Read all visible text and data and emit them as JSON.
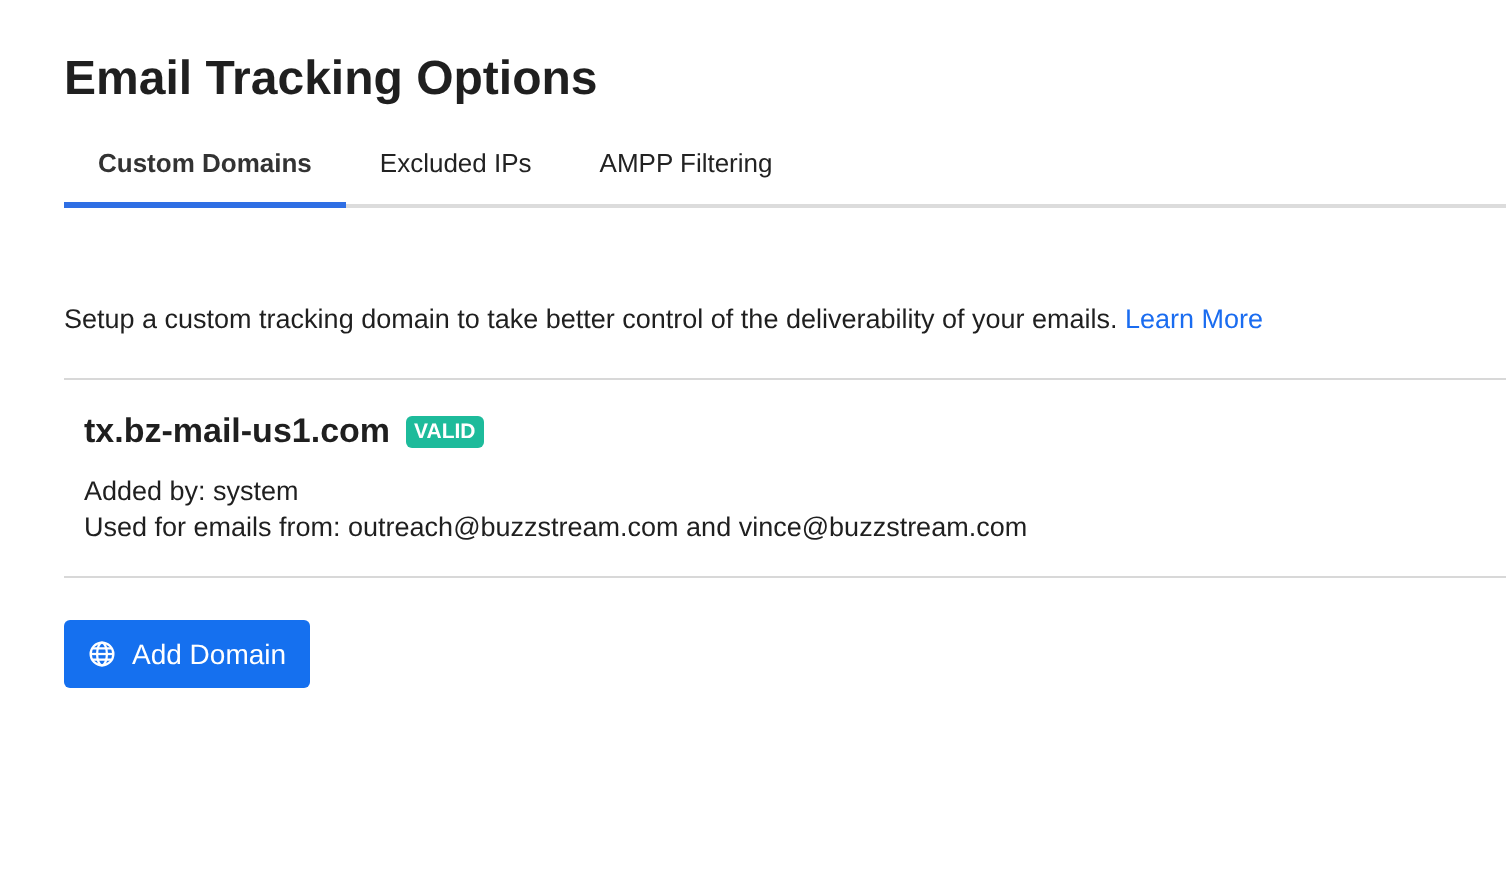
{
  "title": "Email Tracking Options",
  "tabs": [
    {
      "label": "Custom Domains",
      "selected": true
    },
    {
      "label": "Excluded IPs",
      "selected": false
    },
    {
      "label": "AMPP Filtering",
      "selected": false
    }
  ],
  "description": {
    "text": "Setup a custom tracking domain to take better control of the deliverability of your emails.",
    "link": "Learn More"
  },
  "domains": [
    {
      "name": "tx.bz-mail-us1.com",
      "status": {
        "label": "VALID",
        "kind": "valid"
      },
      "details": [
        "Added by: system",
        "Used for emails from: outreach@buzzstream.com and vince@buzzstream.com"
      ]
    }
  ],
  "add_button": {
    "label": "Add Domain"
  }
}
